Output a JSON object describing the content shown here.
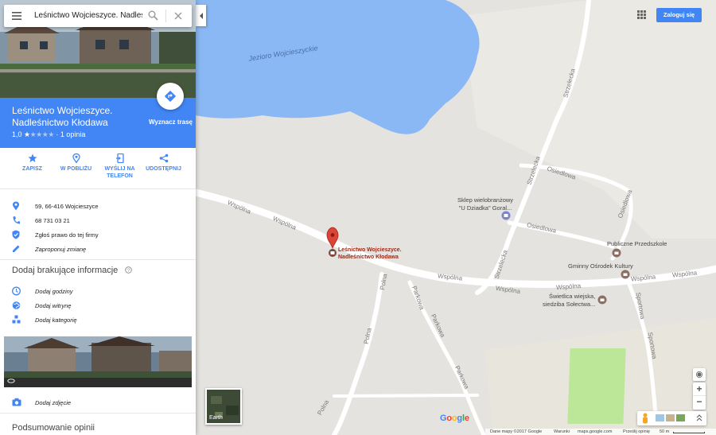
{
  "search": {
    "value": "Leśnictwo Wojcieszyce. Nadleśni"
  },
  "place": {
    "title": "Leśnictwo Wojcieszyce. Nadleśnictwo Kłodawa",
    "rating": "1,0",
    "reviews": "· 1 opinia",
    "directions_label": "Wyznacz trasę"
  },
  "actions": [
    {
      "label": "ZAPISZ",
      "icon": "star-icon"
    },
    {
      "label": "W POBLIŻU",
      "icon": "nearby-icon"
    },
    {
      "label": "WYŚLIJ NA TELEFON",
      "icon": "send-to-phone-icon"
    },
    {
      "label": "UDOSTĘPNIJ",
      "icon": "share-icon"
    }
  ],
  "info": {
    "address": "59, 66-416 Wojcieszyce",
    "phone": "68 731 03 21",
    "claim": "Zgłoś prawo do tej firmy",
    "suggest": "Zaproponuj zmianę"
  },
  "missing": {
    "title": "Dodaj brakujące informacje",
    "hours": "Dodaj godziny",
    "website": "Dodaj witrynę",
    "category": "Dodaj kategorię"
  },
  "photo": {
    "add_label": "Dodaj zdjęcie"
  },
  "reviews_section": {
    "title": "Podsumowanie opinii"
  },
  "header": {
    "signin_label": "Zaloguj się"
  },
  "map": {
    "lake": "Jezioro Wojcieszyckie",
    "marker_label_1": "Leśnictwo Wojcieszyce.",
    "marker_label_2": "Nadleśnictwo Kłodawa",
    "streets": {
      "wspolna_w1": "Wspólna",
      "wspolna_w2": "Wspólna",
      "wspolna_c": "Wspólna",
      "wspolna_e1": "Wspólna",
      "wspolna_e2": "Wspólna",
      "strzelecka_n": "Strzelecka",
      "strzelecka_m": "Strzelecka",
      "strzelecka_s": "Strzelecka",
      "osiedlowa_1": "Osiedlowa",
      "osiedlowa_2": "Osiedlowa",
      "osiedlowa_3": "Osiedlowa",
      "polna_1": "Polna",
      "polna_2": "Polna",
      "polna_3": "Polna",
      "parkowa_1": "Parkowa",
      "parkowa_2": "Parkowa",
      "parkowa_3": "Parkowa",
      "sportowa_1": "Sportowa",
      "sportowa_2": "Sportowa"
    },
    "pois": {
      "shop_1": "Sklep wielobranżowy",
      "shop_2": "\"U Dziadka\" Goral...",
      "school": "Publiczne Przedszkole",
      "culture": "Gminny Ośrodek Kultury",
      "hall_1": "Świetlica wiejska,",
      "hall_2": "siedziba Sołectwa..."
    },
    "earth_label": "Earth",
    "logo": "Google"
  },
  "footer": {
    "data": "Dane mapy ©2017 Google",
    "terms": "Warunki",
    "site": "maps.google.com",
    "feedback": "Prześlij opinię",
    "scale": "50 m"
  },
  "colors": {
    "accent": "#4285f4",
    "water": "#8ab8f4",
    "land": "#e5e3df",
    "road": "#ffffff",
    "park": "#bce698",
    "marker": "#db4437"
  }
}
